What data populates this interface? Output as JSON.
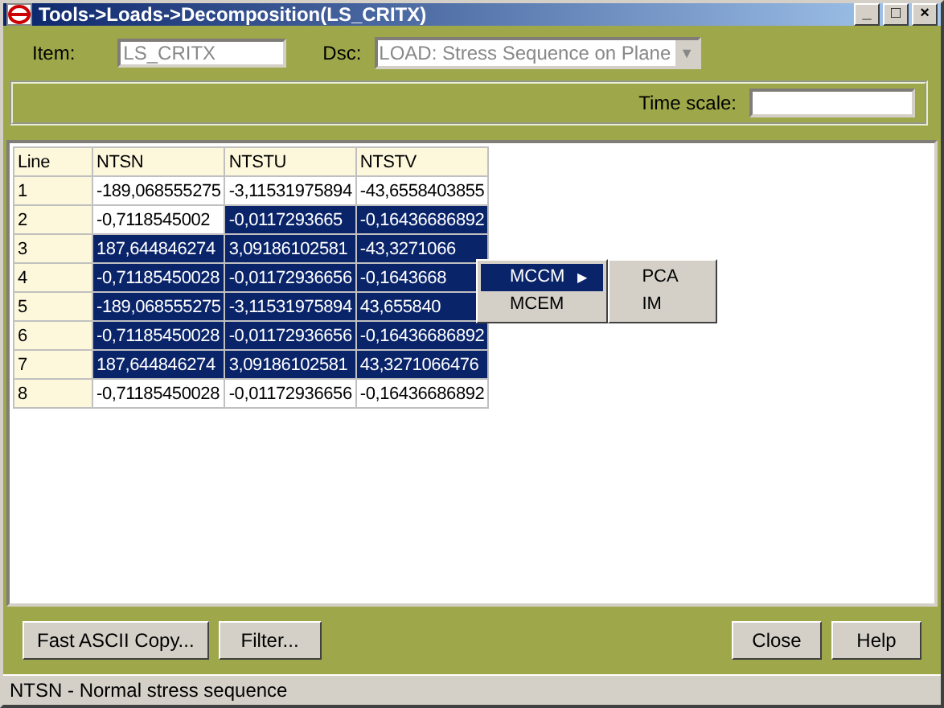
{
  "window": {
    "title": "Tools->Loads->Decomposition(LS_CRITX)",
    "controls": [
      "_",
      "□",
      "×"
    ]
  },
  "item": {
    "label": "Item:",
    "value": "LS_CRITX"
  },
  "dsc": {
    "label": "Dsc:",
    "value": "LOAD: Stress Sequence on Plane",
    "arrow": "▼"
  },
  "time_scale": {
    "label": "Time scale:"
  },
  "table": {
    "columns": [
      "Line",
      "NTSN",
      "NTSTU",
      "NTSTV"
    ],
    "rows": [
      {
        "cells": [
          {
            "text": "1",
            "selected": false
          },
          {
            "text": "-189,068555275",
            "selected": false
          },
          {
            "text": "-3,11531975894",
            "selected": false
          },
          {
            "text": "-43,6558403855",
            "selected": false
          }
        ]
      },
      {
        "cells": [
          {
            "text": "2",
            "selected": false
          },
          {
            "text": "-0,7118545002",
            "selected": false
          },
          {
            "text": "-0,0117293665",
            "selected": true
          },
          {
            "text": "-0,16436686892",
            "selected": true
          }
        ]
      },
      {
        "cells": [
          {
            "text": "3",
            "selected": false
          },
          {
            "text": "187,644846274",
            "selected": true
          },
          {
            "text": "3,09186102581",
            "selected": true
          },
          {
            "text": "-43,3271066",
            "selected": true
          }
        ]
      },
      {
        "cells": [
          {
            "text": "4",
            "selected": false
          },
          {
            "text": "-0,71185450028",
            "selected": true
          },
          {
            "text": "-0,01172936656",
            "selected": true
          },
          {
            "text": "-0,1643668",
            "selected": true
          }
        ]
      },
      {
        "cells": [
          {
            "text": "5",
            "selected": false
          },
          {
            "text": "-189,068555275",
            "selected": true
          },
          {
            "text": "-3,11531975894",
            "selected": true
          },
          {
            "text": "43,655840",
            "selected": true
          }
        ]
      },
      {
        "cells": [
          {
            "text": "6",
            "selected": false
          },
          {
            "text": "-0,71185450028",
            "selected": true
          },
          {
            "text": "-0,01172936656",
            "selected": true
          },
          {
            "text": "-0,16436686892",
            "selected": true
          }
        ]
      },
      {
        "cells": [
          {
            "text": "7",
            "selected": false
          },
          {
            "text": "187,644846274",
            "selected": true
          },
          {
            "text": "3,09186102581",
            "selected": true
          },
          {
            "text": "43,3271066476",
            "selected": true
          }
        ]
      },
      {
        "cells": [
          {
            "text": "8",
            "selected": false
          },
          {
            "text": "-0,71185450028",
            "selected": false
          },
          {
            "text": "-0,01172936656",
            "selected": false
          },
          {
            "text": "-0,16436686892",
            "selected": false
          }
        ]
      }
    ]
  },
  "context_menu": {
    "items": [
      {
        "label": "MCCM",
        "arrow": "▶",
        "selected": true
      },
      {
        "label": "MCEM",
        "selected": false
      }
    ],
    "submenu": [
      {
        "label": "PCA"
      },
      {
        "label": "IM"
      }
    ]
  },
  "buttons_left": [
    "Fast ASCII Copy...",
    "Filter..."
  ],
  "buttons_right": [
    "Close",
    "Help"
  ],
  "status_bar": "NTSN - Normal stress sequence"
}
